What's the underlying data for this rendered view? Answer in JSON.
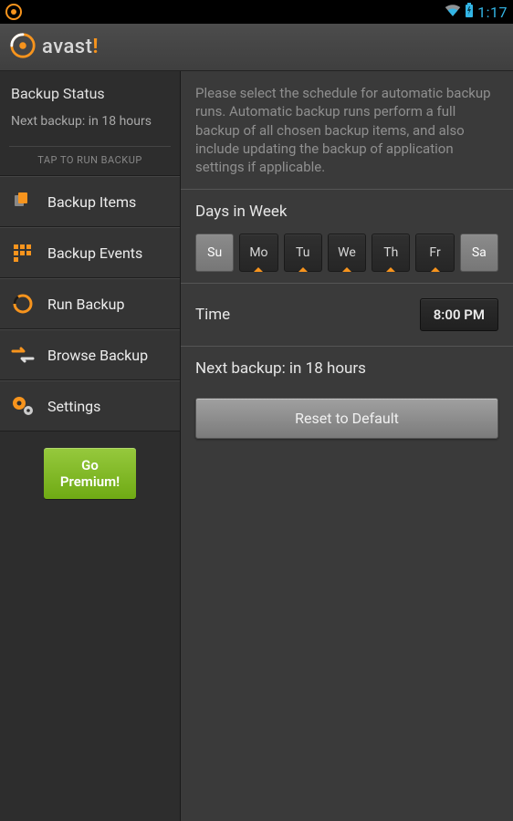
{
  "statusbar": {
    "time": "1:17"
  },
  "titlebar": {
    "brand": "avast",
    "brand_mark": "!"
  },
  "sidebar": {
    "status": {
      "title": "Backup Status",
      "subtitle": "Next backup: in 18 hours"
    },
    "tap_hint": "TAP TO RUN BACKUP",
    "nav": [
      {
        "label": "Backup Items",
        "icon": "backup-items-icon"
      },
      {
        "label": "Backup Events",
        "icon": "backup-events-icon"
      },
      {
        "label": "Run Backup",
        "icon": "run-backup-icon"
      },
      {
        "label": "Browse Backup",
        "icon": "browse-backup-icon"
      },
      {
        "label": "Settings",
        "icon": "settings-icon"
      }
    ],
    "premium_label": "Go\nPremium!"
  },
  "main": {
    "description": "Please select the schedule for automatic backup runs. Automatic backup runs perform a full backup of all chosen backup items, and also include updating the backup of application settings if applicable.",
    "days_label": "Days in Week",
    "days": [
      {
        "label": "Su",
        "selected": true,
        "marked": false
      },
      {
        "label": "Mo",
        "selected": false,
        "marked": true
      },
      {
        "label": "Tu",
        "selected": false,
        "marked": true
      },
      {
        "label": "We",
        "selected": false,
        "marked": true
      },
      {
        "label": "Th",
        "selected": false,
        "marked": true
      },
      {
        "label": "Fr",
        "selected": false,
        "marked": true
      },
      {
        "label": "Sa",
        "selected": true,
        "marked": false
      }
    ],
    "time_label": "Time",
    "time_value": "8:00 PM",
    "next_backup": "Next backup: in 18 hours",
    "reset_label": "Reset to Default"
  },
  "colors": {
    "accent": "#f7941d",
    "premium": "#7bb51d",
    "link": "#33b5e5"
  }
}
